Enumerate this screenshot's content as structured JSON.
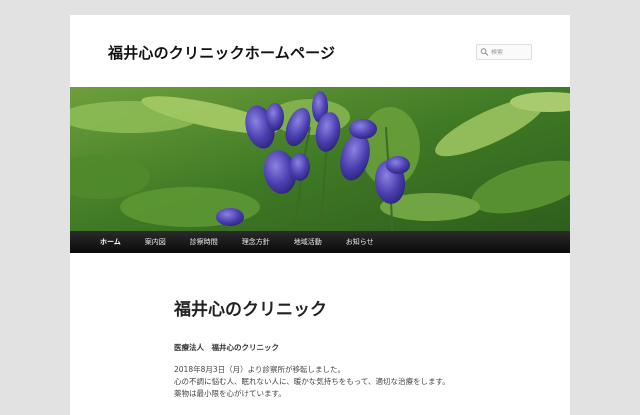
{
  "site": {
    "title": "福井心のクリニックホームページ"
  },
  "search": {
    "placeholder": "検索"
  },
  "nav": {
    "items": [
      "ホーム",
      "案内図",
      "診察時間",
      "理念方針",
      "地域活動",
      "お知らせ"
    ],
    "current": "ホーム"
  },
  "colors": {
    "page_background": "#e2e2e2",
    "nav_bar": "#111111",
    "flower": "#5147b0"
  },
  "content": {
    "title": "福井心のクリニック",
    "organization": "医療法人　福井心のクリニック",
    "body_lines": [
      "2018年8月3日（月）より診察所が移転しました。",
      "心の不調に悩む人、眠れない人に、暖かな気持ちをもって、適切な治療をします。",
      "薬物は最小限を心がけています。"
    ]
  }
}
